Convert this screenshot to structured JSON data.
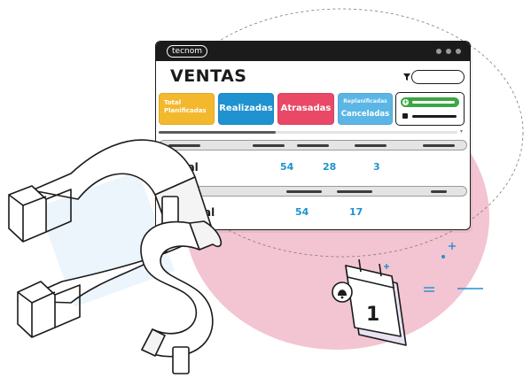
{
  "window": {
    "brand": "tecnom",
    "title": "VENTAS"
  },
  "filter": {
    "placeholder": "",
    "icon": "filter-icon"
  },
  "cards": {
    "planificadas": {
      "line1": "Total",
      "line2": "Planificadas",
      "color": "#f3b82d"
    },
    "realizadas": {
      "label": "Realizadas",
      "color": "#1f92cf"
    },
    "atrasadas": {
      "label": "Atrasadas",
      "color": "#e94967"
    },
    "replanificadas": {
      "line1": "Replanificadas",
      "line2": "Canceladas",
      "color": "#5bb6e6"
    }
  },
  "actions": {
    "add_icon": "plus-circle-icon",
    "add_color": "#3aa744",
    "calendar_icon": "calendar-icon"
  },
  "table": {
    "rows": [
      {
        "label": "Total",
        "values": [
          "54",
          "28",
          "3"
        ]
      },
      {
        "label": "eral",
        "values": [
          "54",
          "17"
        ]
      }
    ]
  },
  "illustration": {
    "calendar_day": "1",
    "currency_symbol": "$",
    "accent_pink": "#f3c4d2",
    "accent_blue": "#1f92cf"
  }
}
